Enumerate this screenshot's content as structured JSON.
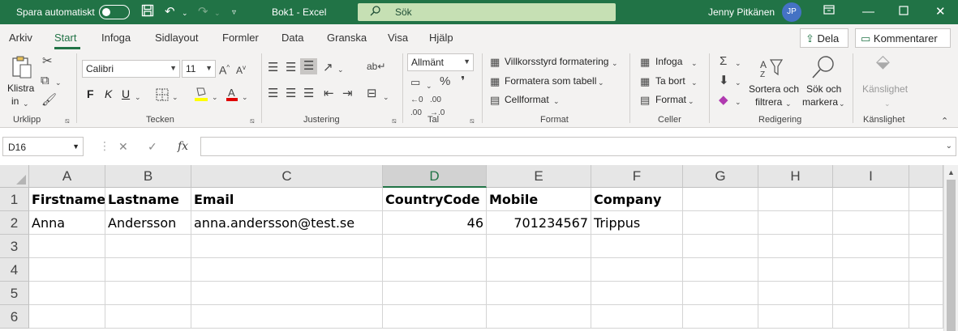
{
  "titlebar": {
    "autosave_label": "Spara automatiskt",
    "doc_title": "Bok1  -  Excel",
    "search_placeholder": "Sök",
    "user_name": "Jenny Pitkänen",
    "user_initials": "JP"
  },
  "menu": {
    "tabs": [
      "Arkiv",
      "Start",
      "Infoga",
      "Sidlayout",
      "Formler",
      "Data",
      "Granska",
      "Visa",
      "Hjälp"
    ],
    "active": "Start",
    "share_label": "Dela",
    "comments_label": "Kommentarer"
  },
  "ribbon": {
    "paste_label": "Klistra",
    "paste_label2": "in",
    "font_name": "Calibri",
    "font_size": "11",
    "number_format": "Allmänt",
    "conditional_formatting": "Villkorsstyrd formatering",
    "format_as_table": "Formatera som tabell",
    "cell_styles": "Cellformat",
    "insert": "Infoga",
    "delete": "Ta bort",
    "format": "Format",
    "sort_filter_1": "Sortera och",
    "sort_filter_2": "filtrera",
    "find_select_1": "Sök och",
    "find_select_2": "markera",
    "sensitivity": "Känslighet",
    "groups": {
      "clipboard": "Urklipp",
      "font": "Tecken",
      "alignment": "Justering",
      "number": "Tal",
      "styles": "Format",
      "cells": "Celler",
      "editing": "Redigering",
      "sensitivity": "Känslighet"
    },
    "bold": "F",
    "italic": "K",
    "underline": "U"
  },
  "formula_bar": {
    "name_box": "D16",
    "fx": "fx",
    "content": ""
  },
  "sheet": {
    "columns": [
      "A",
      "B",
      "C",
      "D",
      "E",
      "F",
      "G",
      "H",
      "I"
    ],
    "selected_column": "D",
    "rows": [
      "1",
      "2",
      "3",
      "4",
      "5",
      "6"
    ],
    "row1": [
      "Firstname",
      "Lastname",
      "Email",
      "CountryCode",
      "Mobile",
      "Company"
    ],
    "row2": [
      "Anna",
      "Andersson",
      "anna.andersson@test.se",
      "46",
      "701234567",
      "Trippus"
    ]
  },
  "colors": {
    "brand_green": "#217346",
    "search_bg": "#c6e0b4",
    "avatar_bg": "#4472c4"
  }
}
